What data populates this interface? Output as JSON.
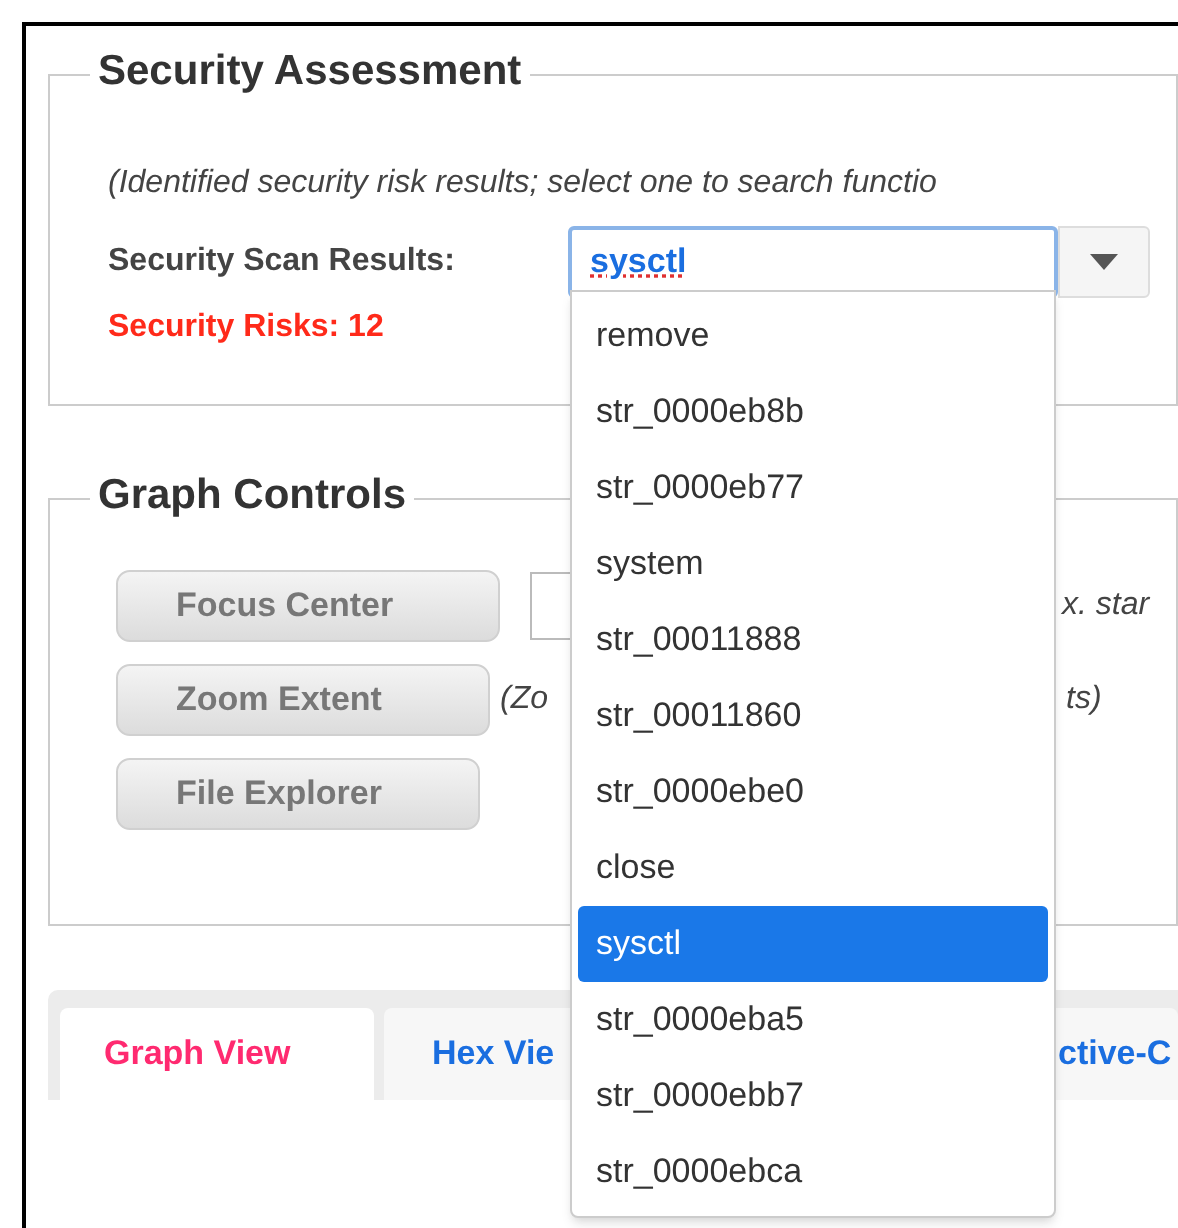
{
  "assessment": {
    "title": "Security Assessment",
    "note": "(Identified security risk results; select one to search functio",
    "scan_label": "Security Scan Results:",
    "scan_value": "sysctl",
    "risks": "Security Risks: 12",
    "options": [
      {
        "label": "remove",
        "selected": false
      },
      {
        "label": "str_0000eb8b",
        "selected": false
      },
      {
        "label": "str_0000eb77",
        "selected": false
      },
      {
        "label": "system",
        "selected": false
      },
      {
        "label": "str_00011888",
        "selected": false
      },
      {
        "label": "str_00011860",
        "selected": false
      },
      {
        "label": "str_0000ebe0",
        "selected": false
      },
      {
        "label": "close",
        "selected": false
      },
      {
        "label": "sysctl",
        "selected": true
      },
      {
        "label": "str_0000eba5",
        "selected": false
      },
      {
        "label": "str_0000ebb7",
        "selected": false
      },
      {
        "label": "str_0000ebca",
        "selected": false
      }
    ]
  },
  "graph_controls": {
    "title": "Graph Controls",
    "rows": [
      {
        "kind": "input",
        "button": "Focus Center",
        "note_end": "x. star"
      },
      {
        "kind": "note",
        "button": "Zoom Extent",
        "note_start": "(Zo",
        "note_end": "ts)"
      },
      {
        "kind": "plain",
        "button": "File Explorer"
      }
    ]
  },
  "tabs": [
    {
      "label": "Graph View",
      "selected": true
    },
    {
      "label": "Hex Vie",
      "selected": false
    },
    {
      "label": "ctive-C",
      "selected": false
    }
  ]
}
